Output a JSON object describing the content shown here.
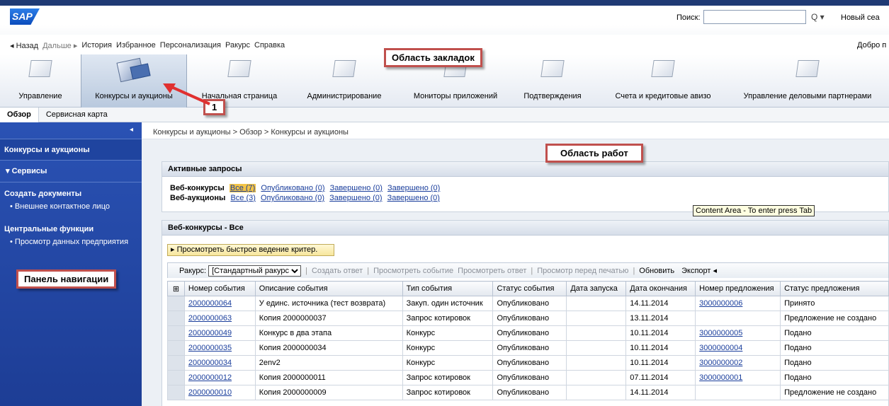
{
  "header": {
    "logo": "SAP",
    "search_label": "Поиск:",
    "search_value": "",
    "search_icon": "Q ▾",
    "new_session": "Новый сеа"
  },
  "nav": {
    "back": "◂ Назад",
    "forward": "Дальше ▸",
    "items": [
      "История",
      "Избранное",
      "Персонализация",
      "Ракурс",
      "Справка"
    ],
    "welcome": "Добро п"
  },
  "tabs": [
    {
      "label": "Управление",
      "icon": "folder-icon"
    },
    {
      "label": "Конкурсы и аукционы",
      "icon": "folder-open-icon",
      "active": true
    },
    {
      "label": "Начальная страница",
      "icon": "folder-icon"
    },
    {
      "label": "Администрирование",
      "icon": "folder-icon"
    },
    {
      "label": "Мониторы приложений",
      "icon": "folder-icon"
    },
    {
      "label": "Подтверждения",
      "icon": "folder-icon"
    },
    {
      "label": "Счета и кредитовые авизо",
      "icon": "folder-icon"
    },
    {
      "label": "Управление деловыми партнерами",
      "icon": "folder-icon"
    }
  ],
  "subtabs": [
    "Обзор",
    "Сервисная карта"
  ],
  "sidebar": {
    "collapse_icon": "◂",
    "title": "Конкурсы и аукционы",
    "services": "▾  Сервисы",
    "section1": "Создать документы",
    "section1_item": "• Внешнее контактное лицо",
    "section2": "Центральные функции",
    "section2_item": "• Просмотр данных предприятия"
  },
  "breadcrumb": "Конкурсы и аукционы  >  Обзор  >  Конкурсы и аукционы",
  "active_requests": {
    "title": "Активные запросы",
    "rows": [
      {
        "label": "Веб-конкурсы",
        "links": [
          "Все (7)",
          "Опубликовано (0)",
          "Завершено (0)",
          "Завершено (0)"
        ]
      },
      {
        "label": "Веб-аукционы",
        "links": [
          "Все (3)",
          "Опубликовано (0)",
          "Завершено (0)",
          "Завершено (0)"
        ]
      }
    ]
  },
  "tooltip": "Content Area - To enter press Tab",
  "tenders_panel": {
    "title": "Веб-конкурсы - Все",
    "quick_criteria": "▸ Просмотреть быстрое ведение критер.",
    "toolbar": {
      "view_label": "Ракурс:",
      "view_value": "[Стандартный ракурс",
      "create_answer": "Создать ответ",
      "view_event": "Просмотреть событие",
      "view_answer": "Просмотреть ответ",
      "print_preview": "Просмотр перед печатью",
      "refresh": "Обновить",
      "export": "Экспорт ◂"
    },
    "columns": [
      "Номер события",
      "Описание события",
      "Тип события",
      "Статус события",
      "Дата запуска",
      "Дата окончания",
      "Номер предложения",
      "Статус предложения"
    ],
    "rows": [
      [
        "2000000064",
        "У единс. источника (тест возврата)",
        "Закуп. один источник",
        "Опубликовано",
        "",
        "14.11.2014",
        "3000000006",
        "Принято"
      ],
      [
        "2000000063",
        "Копия 2000000037",
        "Запрос котировок",
        "Опубликовано",
        "",
        "13.11.2014",
        "",
        "Предложение не создано"
      ],
      [
        "2000000049",
        "Конкурс в два этапа",
        "Конкурс",
        "Опубликовано",
        "",
        "10.11.2014",
        "3000000005",
        "Подано"
      ],
      [
        "2000000035",
        "Копия 2000000034",
        "Конкурс",
        "Опубликовано",
        "",
        "10.11.2014",
        "3000000004",
        "Подано"
      ],
      [
        "2000000034",
        "2env2",
        "Конкурс",
        "Опубликовано",
        "",
        "10.11.2014",
        "3000000002",
        "Подано"
      ],
      [
        "2000000012",
        "Копия 2000000011",
        "Запрос котировок",
        "Опубликовано",
        "",
        "07.11.2014",
        "3000000001",
        "Подано"
      ],
      [
        "2000000010",
        "Копия 2000000009",
        "Запрос котировок",
        "Опубликовано",
        "",
        "14.11.2014",
        "",
        "Предложение не создано"
      ]
    ]
  },
  "callouts": {
    "tabs_area": "Область закладок",
    "work_area": "Область работ",
    "nav_panel": "Панель навигации",
    "marker": "1"
  },
  "colors": {
    "sidebar": "#1f449f",
    "callout_border": "#c0504d",
    "link": "#1a3e9c",
    "highlight": "#f3c447"
  }
}
